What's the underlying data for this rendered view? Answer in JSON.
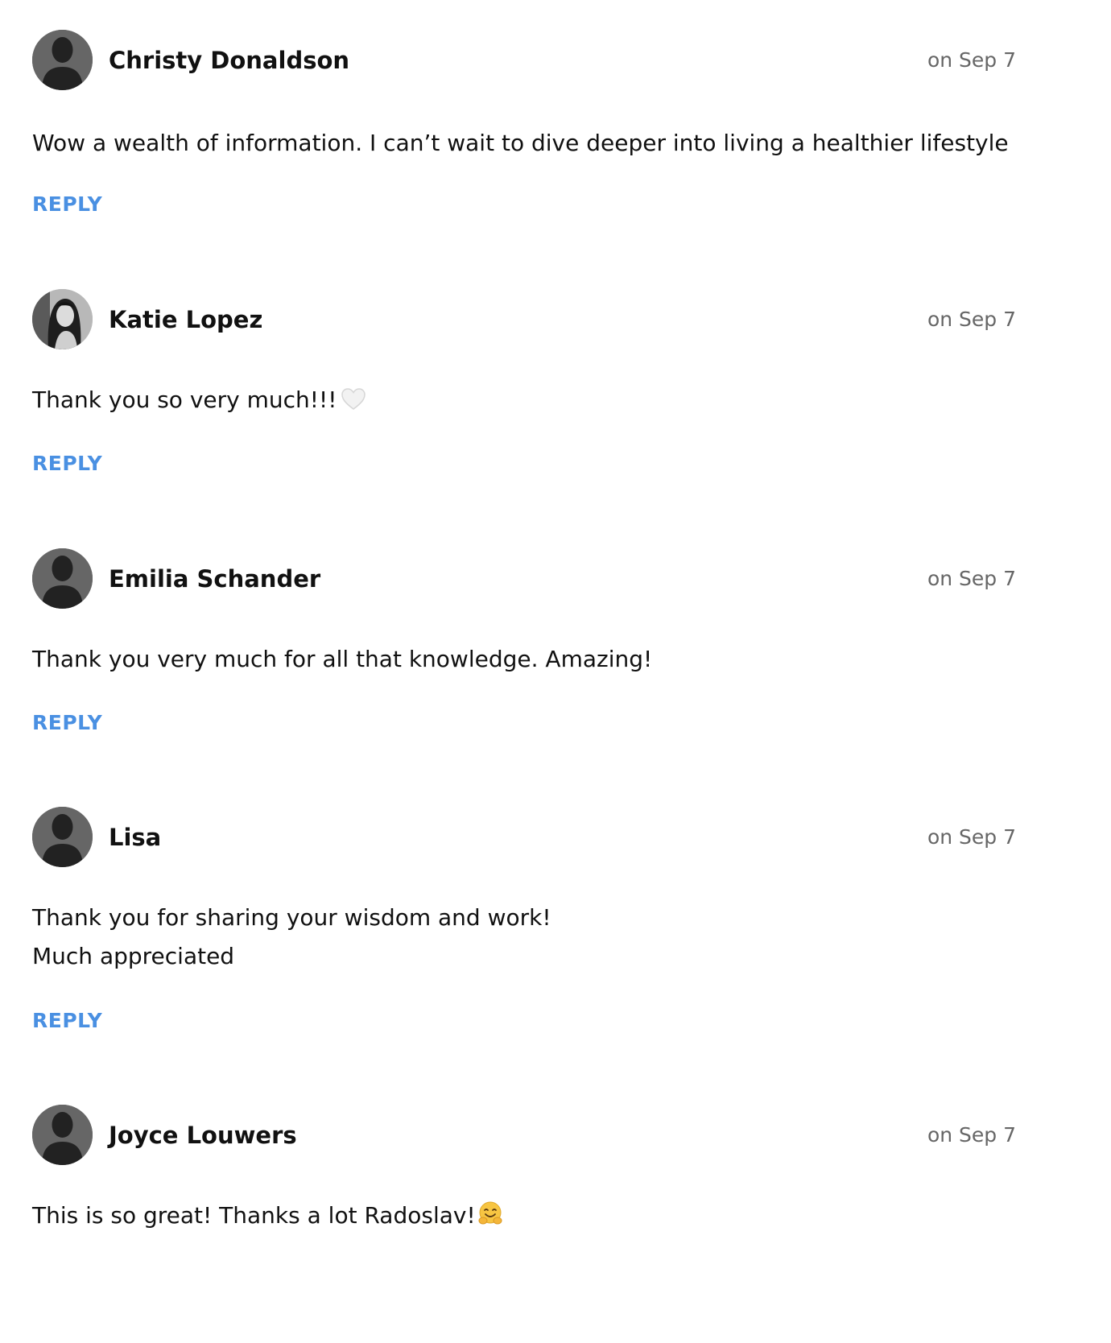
{
  "comments": [
    {
      "author": "Christy Donaldson",
      "date": "on Sep 7",
      "avatar": "default-silhouette",
      "text": "Wow a wealth of information. I can’t wait to dive deeper into living a healthier lifestyle",
      "reply_label": "REPLY"
    },
    {
      "author": "Katie Lopez",
      "date": "on Sep 7",
      "avatar": "photo",
      "text": "Thank you so very much!!!",
      "emoji": "white-heart-icon",
      "reply_label": "REPLY"
    },
    {
      "author": "Emilia Schander",
      "date": "on Sep 7",
      "avatar": "default-silhouette",
      "text": "Thank you very much for all that knowledge. Amazing!",
      "reply_label": "REPLY"
    },
    {
      "author": "Lisa",
      "date": "on Sep 7",
      "avatar": "default-silhouette",
      "text": "Thank you for sharing your wisdom and work!\nMuch appreciated",
      "reply_label": "REPLY"
    },
    {
      "author": "Joyce Louwers",
      "date": "on Sep 7",
      "avatar": "default-silhouette",
      "text": "This is so great! Thanks a lot Radoslav!",
      "emoji": "hugging-face-icon"
    }
  ],
  "colors": {
    "reply_link": "#4a90e2",
    "date_text": "#666666",
    "avatar_background": "#666666",
    "avatar_silhouette": "#222222"
  }
}
